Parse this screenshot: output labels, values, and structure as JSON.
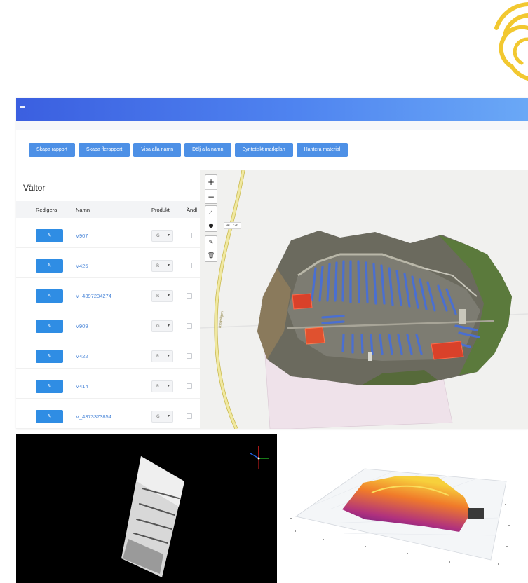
{
  "toolbar": {
    "menu_glyph": "≡",
    "buttons": [
      {
        "label": "Skapa rapport"
      },
      {
        "label": "Skapa flerapport"
      },
      {
        "label": "Visa alla namn"
      },
      {
        "label": "Dölj alla namn"
      },
      {
        "label": "Syntetiskt markplan"
      },
      {
        "label": "Hantera material"
      }
    ]
  },
  "panel": {
    "title": "Vältor",
    "columns": {
      "edit": "Redigera",
      "name": "Namn",
      "product": "Produkt",
      "changed": "Ändl"
    },
    "edit_icon": "edit-icon",
    "edit_glyph": "✎",
    "select_caret": "▾",
    "rows": [
      {
        "name": "V907",
        "product": "G"
      },
      {
        "name": "V425",
        "product": "R"
      },
      {
        "name": "V_4397234274",
        "product": "R"
      },
      {
        "name": "V909",
        "product": "G"
      },
      {
        "name": "V422",
        "product": "R"
      },
      {
        "name": "V414",
        "product": "R"
      },
      {
        "name": "V_4373373854",
        "product": "G"
      }
    ]
  },
  "map": {
    "zoom_in": "+",
    "zoom_out": "−",
    "draw_line_glyph": "⟋",
    "draw_point_glyph": "●",
    "edit_glyph": "✎",
    "delete_glyph": "🗑",
    "road_label": "AC 726",
    "road_name": "Ringvägen",
    "colors": {
      "road": "#f0e8a0",
      "road_edge": "#c8b84a",
      "region": "#efe2ea",
      "pile": "#4a6fd1",
      "material": "#d9412a"
    }
  },
  "colors": {
    "accent": "#4d90e6",
    "edit_button": "#2f8de4",
    "link": "#4a86d8"
  }
}
